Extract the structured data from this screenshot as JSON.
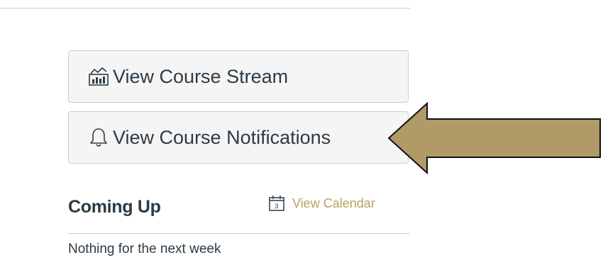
{
  "buttons": {
    "stream": {
      "label": "View Course Stream",
      "icon": "course-stream-icon"
    },
    "notifications": {
      "label": "View Course Notifications",
      "icon": "bell-icon"
    }
  },
  "coming_up": {
    "title": "Coming Up",
    "calendar_link": "View Calendar",
    "calendar_icon": "calendar-icon",
    "empty_message": "Nothing for the next week"
  },
  "colors": {
    "arrow_fill": "#B09A67",
    "link_gold": "#B8A25C",
    "text": "#2D3B45",
    "button_bg": "#F5F5F5",
    "border": "#C7CDD1"
  }
}
